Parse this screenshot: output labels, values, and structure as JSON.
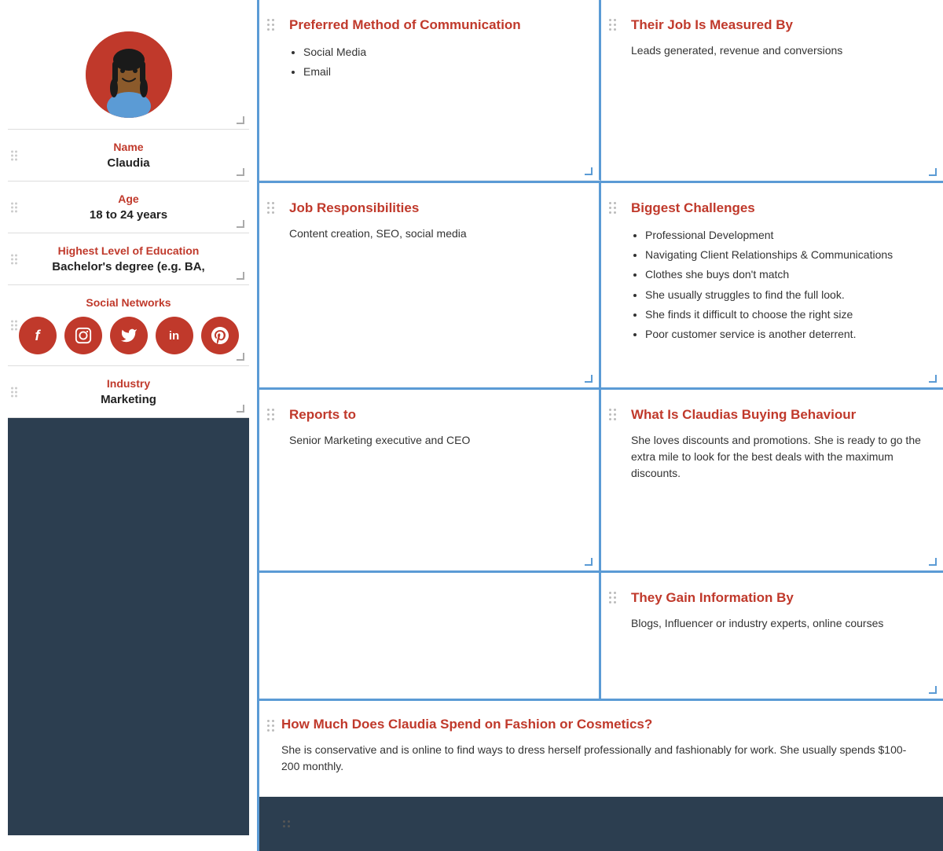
{
  "sidebar": {
    "name_label": "Name",
    "name_value": "Claudia",
    "age_label": "Age",
    "age_value": "18 to 24 years",
    "education_label": "Highest Level of Education",
    "education_value": "Bachelor's degree (e.g. BA,",
    "social_label": "Social Networks",
    "social_icons": [
      "f",
      "in-ig",
      "t",
      "in",
      "p"
    ],
    "industry_label": "Industry",
    "industry_value": "Marketing"
  },
  "cells": {
    "preferred_comm_title": "Preferred Method of Communication",
    "preferred_comm_items": [
      "Social Media",
      "Email"
    ],
    "job_measured_title": "Their Job Is Measured By",
    "job_measured_text": "Leads generated, revenue and conversions",
    "job_resp_title": "Job Responsibilities",
    "job_resp_text": "Content creation, SEO, social media",
    "biggest_challenges_title": "Biggest Challenges",
    "biggest_challenges_items": [
      "Professional Development",
      "Navigating Client Relationships & Communications",
      "Clothes she buys don't match",
      "She usually struggles to find the full look.",
      "She finds it difficult to choose the right size",
      "Poor customer service is another deterrent."
    ],
    "reports_to_title": "Reports to",
    "reports_to_text": "Senior Marketing executive and CEO",
    "buying_title": "What Is Claudias Buying Behaviour",
    "buying_text": "She loves discounts and promotions. She is ready to go the extra mile to look for the best deals with the maximum discounts.",
    "gain_info_title": "They Gain Information By",
    "gain_info_text": "Blogs, Influencer or industry experts, online courses",
    "bottom_title": "How Much Does Claudia Spend on Fashion or Cosmetics?",
    "bottom_text": "She is conservative and is online to find ways to dress herself professionally and fashionably for work. She usually spends $100-200 monthly."
  }
}
